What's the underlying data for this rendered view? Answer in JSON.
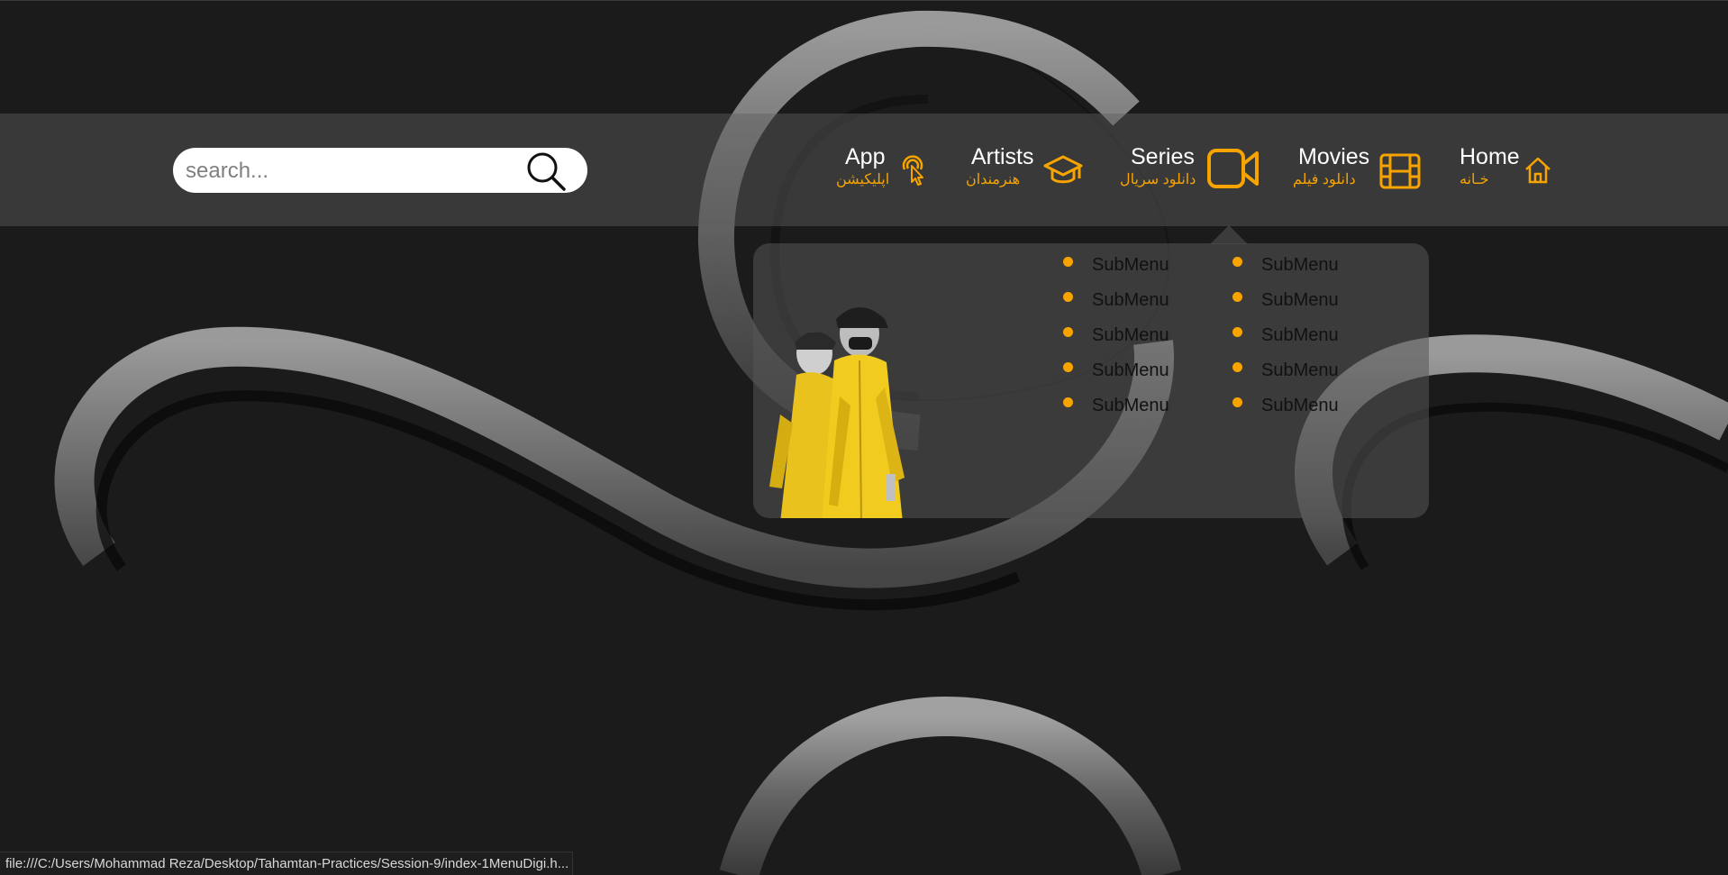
{
  "search": {
    "placeholder": "search..."
  },
  "nav": {
    "items": [
      {
        "label": "Home",
        "sublabel": "خـانه",
        "icon": "home-icon"
      },
      {
        "label": "Movies",
        "sublabel": "دانلود فیلم",
        "icon": "film-icon"
      },
      {
        "label": "Series",
        "sublabel": "دانلود سریال",
        "icon": "video-camera-icon"
      },
      {
        "label": "Artists",
        "sublabel": "هنرمندان",
        "icon": "graduation-cap-icon"
      },
      {
        "label": "App",
        "sublabel": "اپلیکیشن",
        "icon": "touch-pointer-icon"
      }
    ]
  },
  "dropdown": {
    "column_right": [
      "SubMenu",
      "SubMenu",
      "SubMenu",
      "SubMenu",
      "SubMenu"
    ],
    "column_left": [
      "SubMenu",
      "SubMenu",
      "SubMenu",
      "SubMenu",
      "SubMenu"
    ]
  },
  "status": {
    "url": "file:///C:/Users/Mohammad Reza/Desktop/Tahamtan-Practices/Session-9/index-1MenuDigi.h..."
  },
  "colors": {
    "accent": "#f7a400",
    "background": "#1b1b1b",
    "navbar": "#4a4a4a"
  }
}
